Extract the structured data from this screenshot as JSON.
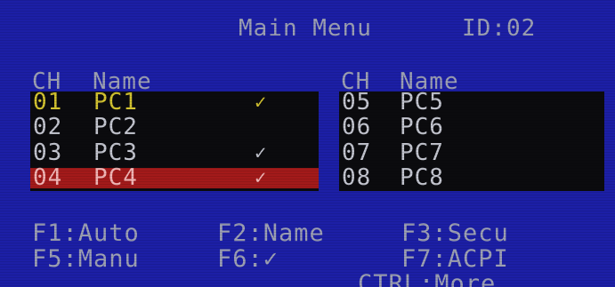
{
  "title": {
    "label": "Main Menu",
    "id_text": "ID:02"
  },
  "columns": {
    "ch": "CH",
    "name": "Name"
  },
  "left_list": [
    {
      "ch": "01",
      "name": "PC1",
      "mark": "✓",
      "state": "active"
    },
    {
      "ch": "02",
      "name": "PC2",
      "mark": "",
      "state": "normal"
    },
    {
      "ch": "03",
      "name": "PC3",
      "mark": "✓",
      "state": "normal"
    },
    {
      "ch": "04",
      "name": "PC4",
      "mark": "✓",
      "state": "selected"
    }
  ],
  "right_list": [
    {
      "ch": "05",
      "name": "PC5",
      "mark": ""
    },
    {
      "ch": "06",
      "name": "PC6",
      "mark": ""
    },
    {
      "ch": "07",
      "name": "PC7",
      "mark": ""
    },
    {
      "ch": "08",
      "name": "PC8",
      "mark": ""
    }
  ],
  "function_keys": {
    "f1": "F1:Auto",
    "f2": "F2:Name",
    "f3": "F3:Secu",
    "f5": "F5:Manu",
    "f6": "F6:✓",
    "f7": "F7:ACPI",
    "ctrl": "CTRL:More..."
  },
  "colors": {
    "background": "#1c1fa6",
    "list_panel": "#0b0b0e",
    "text": "#9da0b4",
    "active_text": "#d4c431",
    "selected_bar": "#a31a1a"
  }
}
